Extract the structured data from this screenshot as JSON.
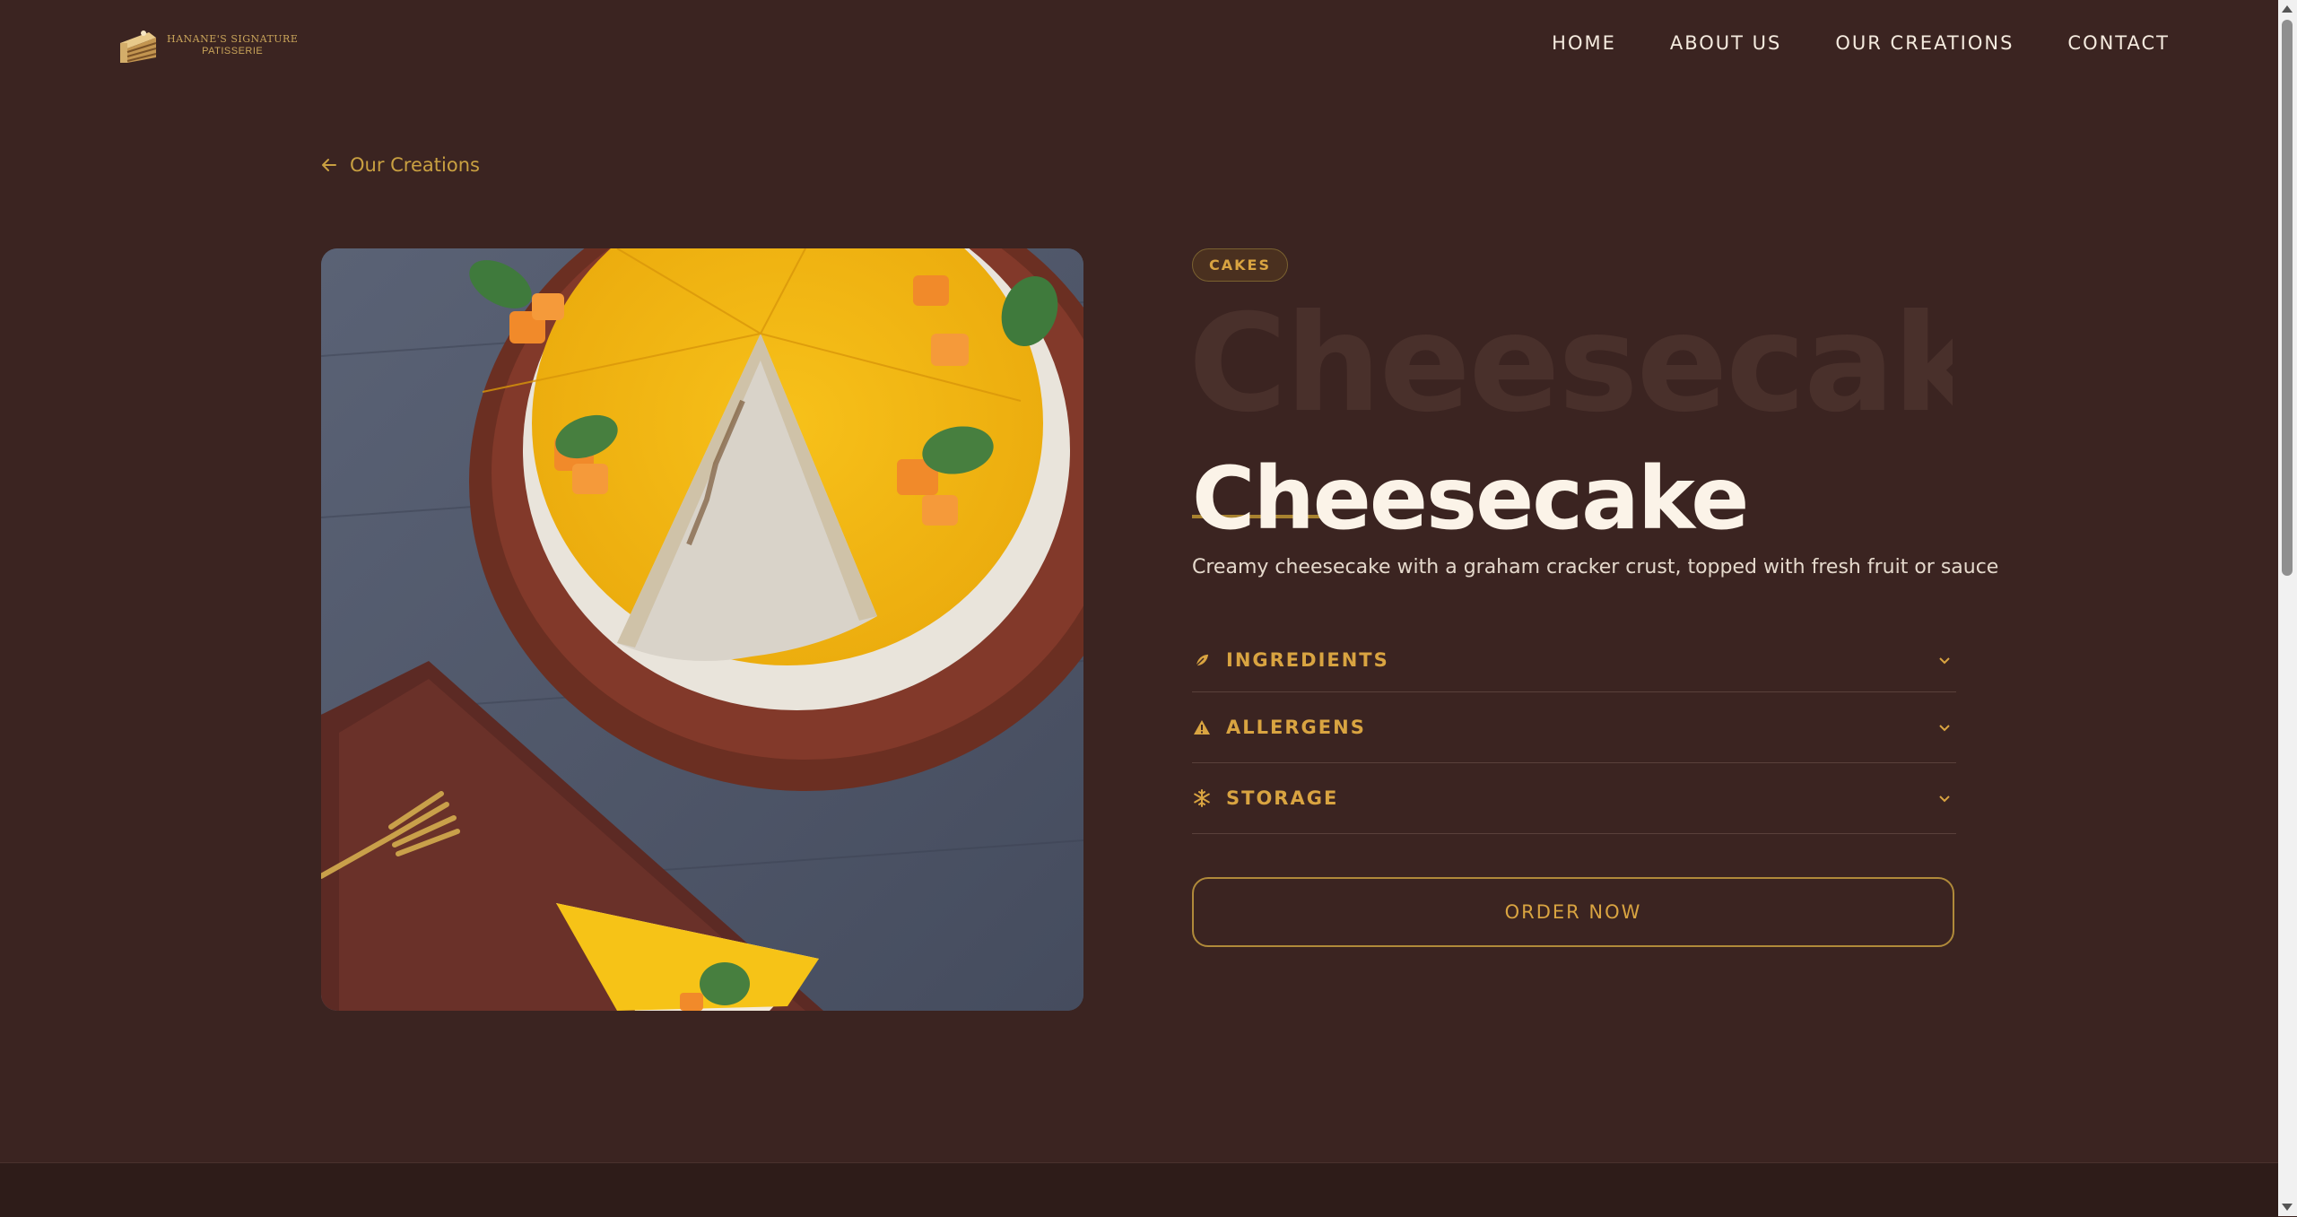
{
  "brand": {
    "line1": "HANANE'S SIGNATURE",
    "line2": "PATISSERIE"
  },
  "nav": [
    {
      "label": "HOME"
    },
    {
      "label": "ABOUT US"
    },
    {
      "label": "OUR CREATIONS"
    },
    {
      "label": "CONTACT"
    }
  ],
  "back_link": {
    "label": "Our Creations",
    "icon": "arrow-left-icon"
  },
  "product": {
    "category": "CAKES",
    "title_ghost": "Cheesecake",
    "title": "Cheesecake",
    "description": "Creamy cheesecake with a graham cracker crust, topped with fresh fruit or sauce",
    "image_alt": "Mango cheesecake with mint leaves on a wooden board"
  },
  "accordion": [
    {
      "label": "INGREDIENTS",
      "icon": "leaf-icon"
    },
    {
      "label": "ALLERGENS",
      "icon": "warning-icon"
    },
    {
      "label": "STORAGE",
      "icon": "snowflake-icon"
    }
  ],
  "cta": {
    "label": "ORDER NOW"
  },
  "colors": {
    "background": "#3b2421",
    "accent": "#d9a441",
    "text": "#f5ebdf"
  }
}
